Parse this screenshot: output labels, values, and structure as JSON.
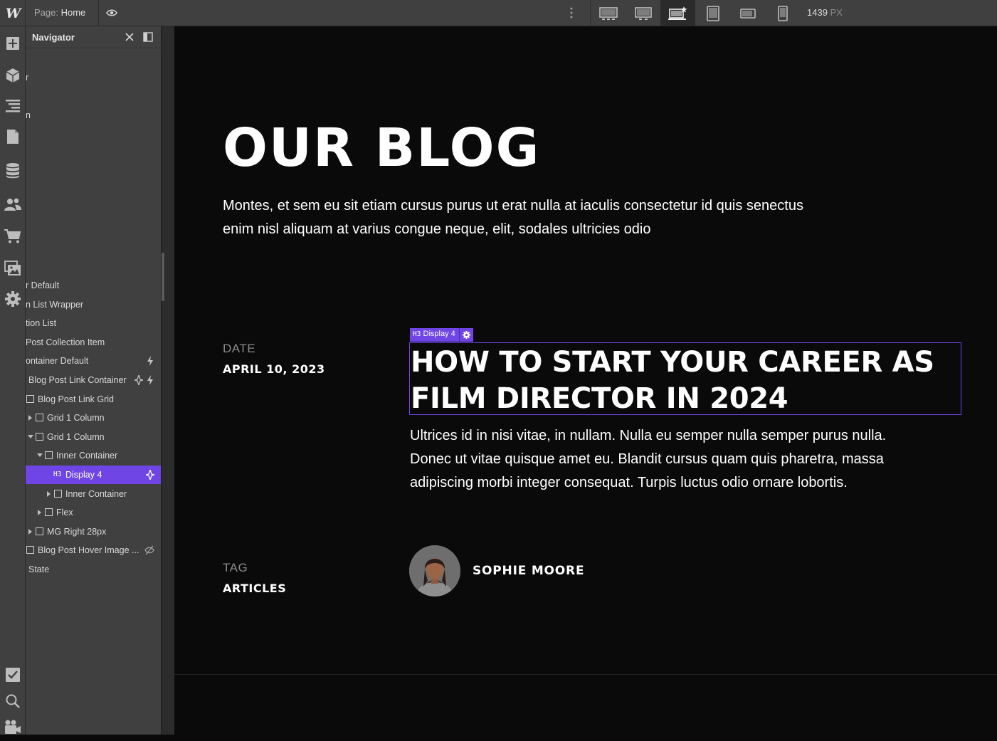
{
  "topbar": {
    "logo": "W",
    "page_prefix": "Page:",
    "page_name": "Home",
    "breakpoints": [
      "desktop-xl-icon",
      "desktop-large-icon",
      "desktop-base-icon",
      "tablet-icon",
      "mobile-landscape-icon",
      "mobile-portrait-icon"
    ],
    "active_breakpoint": 2,
    "width_value": "1439",
    "width_unit": "PX"
  },
  "tools": [
    "add-icon",
    "components-icon",
    "navigator-icon",
    "pages-icon",
    "cms-icon",
    "users-icon",
    "ecommerce-icon",
    "assets-icon",
    "settings-icon",
    "tasks-icon",
    "search-icon",
    "video-icon"
  ],
  "navigator": {
    "title": "Navigator",
    "items": [
      {
        "label": "r",
        "top": 0
      },
      {
        "label": "n",
        "top": 0
      },
      {
        "label": "r Default"
      },
      {
        "label": "n List Wrapper"
      },
      {
        "label": "tion List"
      },
      {
        "label": "Post Collection Item"
      },
      {
        "label": "ontainer Default"
      },
      {
        "label": "Blog Post Link Container"
      },
      {
        "label": "Blog Post Link Grid"
      },
      {
        "label": "Grid 1 Column"
      },
      {
        "label": "Grid 1 Column"
      },
      {
        "label": "Inner Container"
      },
      {
        "label": "Display 4",
        "tag": "H3"
      },
      {
        "label": "Inner Container"
      },
      {
        "label": "Flex"
      },
      {
        "label": "MG Right 28px"
      },
      {
        "label": "Blog Post Hover Image ..."
      },
      {
        "label": "State"
      }
    ]
  },
  "canvas": {
    "title": "OUR BLOG",
    "intro": "Montes, et sem eu sit etiam cursus purus ut erat nulla at iaculis consectetur id quis senectus enim nisl aliquam at varius congue neque, elit, sodales ultricies odio",
    "date_label": "DATE",
    "date_value": "APRIL 10, 2023",
    "selection_badge_tag": "H3",
    "selection_badge_name": "Display 4",
    "post_title": "HOW TO START YOUR CAREER AS FILM DIRECTOR IN 2024",
    "post_excerpt": "Ultrices id in nisi vitae, in nullam. Nulla eu semper nulla semper purus nulla. Donec ut vitae quisque amet eu. Blandit cursus quam quis pharetra, massa adipiscing morbi integer consequat. Turpis luctus odio ornare lobortis.",
    "tag_label": "TAG",
    "tag_value": "ARTICLES",
    "author_name": "SOPHIE MOORE"
  },
  "colors": {
    "accent": "#6f45e6",
    "panel": "#404040",
    "canvas_bg": "#0a0a0a"
  }
}
